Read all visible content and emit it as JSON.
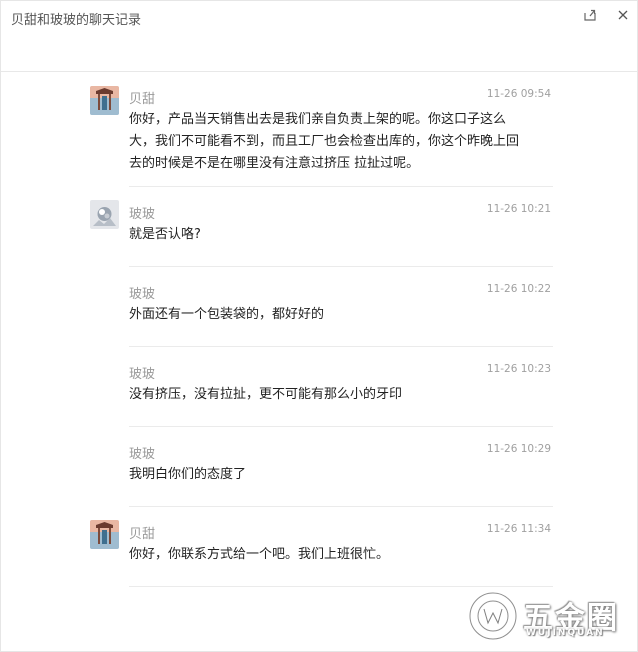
{
  "window": {
    "title": "贝甜和玻玻的聊天记录"
  },
  "messages": [
    {
      "sender": "贝甜",
      "time": "11-26 09:54",
      "text": "你好，产品当天销售出去是我们亲自负责上架的呢。你这口子这么大，我们不可能看不到，而且工厂也会检查出库的，你这个昨晚上回去的时候是不是在哪里没有注意过挤压 拉扯过呢。",
      "avatar": "shop-avatar"
    },
    {
      "sender": "玻玻",
      "time": "11-26 10:21",
      "text": "就是否认咯?",
      "avatar": "customer-avatar"
    },
    {
      "sender": "玻玻",
      "time": "11-26 10:22",
      "text": "外面还有一个包装袋的，都好好的"
    },
    {
      "sender": "玻玻",
      "time": "11-26 10:23",
      "text": "没有挤压，没有拉扯，更不可能有那么小的牙印"
    },
    {
      "sender": "玻玻",
      "time": "11-26 10:29",
      "text": "我明白你们的态度了"
    },
    {
      "sender": "贝甜",
      "time": "11-26 11:34",
      "text": "你好，你联系方式给一个吧。我们上班很忙。",
      "avatar": "shop-avatar"
    }
  ],
  "watermark": {
    "cn": "五金圈",
    "en": "WUJINQUAN"
  }
}
